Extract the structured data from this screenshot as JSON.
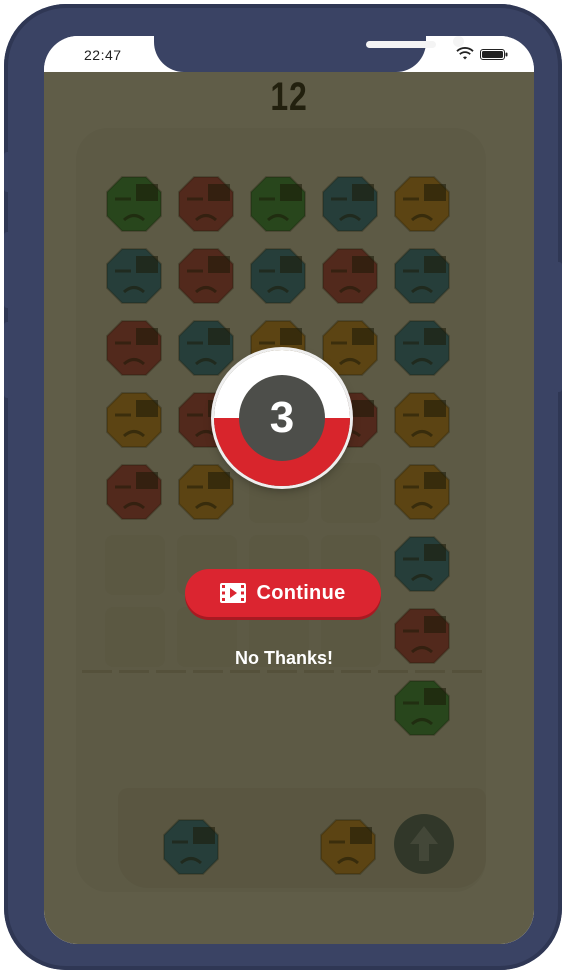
{
  "status_bar": {
    "time": "22:47",
    "wifi_icon": "wifi-icon",
    "battery_icon": "battery-icon"
  },
  "game": {
    "score": "12",
    "countdown": "3",
    "continue_label": "Continue",
    "continue_icon": "video-ad-icon",
    "no_thanks_label": "No Thanks!",
    "shooter_icon": "up-arrow-icon"
  },
  "colors": {
    "green": "#2fa04e",
    "red": "#c63a4d",
    "blue": "#2a87b8",
    "orange": "#e89a2b",
    "accent_red": "#db2530",
    "overlay": "#26220a"
  },
  "board": {
    "grid": [
      [
        "green",
        "red",
        "green",
        "blue",
        "orange"
      ],
      [
        "blue",
        "red",
        "blue",
        "red",
        "blue"
      ],
      [
        "red",
        "blue",
        "orange",
        "orange",
        "blue"
      ],
      [
        "orange",
        "red",
        "",
        "red",
        "orange"
      ],
      [
        "red",
        "orange",
        "",
        "",
        "orange"
      ],
      [
        "",
        "",
        "",
        "",
        "blue"
      ],
      [
        "",
        "",
        "",
        "",
        "red"
      ],
      [
        "",
        "",
        "",
        "",
        "green"
      ]
    ],
    "tray": [
      "blue",
      "orange"
    ]
  }
}
